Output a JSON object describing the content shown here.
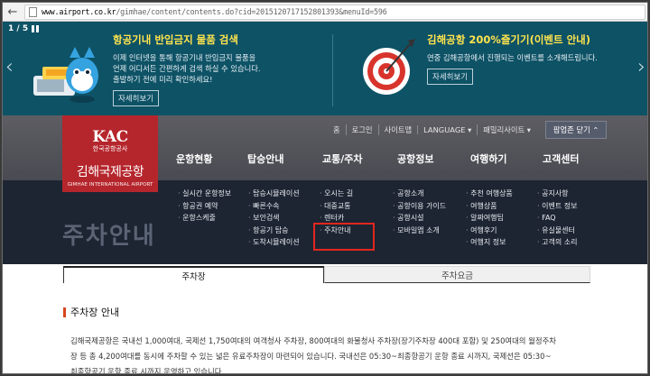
{
  "browser": {
    "url_host": "www.airport.co.kr",
    "url_rest": "/gimhae/content/contents.do?cid=2015120717152801393&menuId=596"
  },
  "banner": {
    "counter": "1 / 5",
    "slides": [
      {
        "title": "항공기내 반입금지 물품 검색",
        "lines": [
          "이제 인터넷을 통해 항공기내 반입금지 물품을",
          "언제 어디서든 간편하게 검색 하실 수 있습니다.",
          "출발하기 전에 미리 확인하세요!"
        ],
        "more": "자세히보기"
      },
      {
        "title": "김해공항 200%즐기기(이벤트 안내)",
        "lines": [
          "연중 김해공항에서 진행되는 이벤트를 소개해드립니다."
        ],
        "more": "자세히보기"
      }
    ]
  },
  "logo": {
    "kac": "KAC",
    "org": "한국공항공사",
    "name": "김해국제공항",
    "name_en": "GIMHAE INTERNATIONAL AIRPORT"
  },
  "util": {
    "items": [
      "홈",
      "로그인",
      "사이트맵",
      "LANGUAGE ▾",
      "패밀리사이트 ▾"
    ],
    "close_popup": "팝업존 닫기 ⌃"
  },
  "gnb": [
    "운항현황",
    "탑승안내",
    "교통/주차",
    "공항정보",
    "여행하기",
    "고객센터"
  ],
  "submenus": [
    [
      "실시간 운항정보",
      "항공권 예약",
      "운항스케줄"
    ],
    [
      "탑승시뮬레이션",
      "빠른수속",
      "보안검색",
      "항공기 탑승",
      "도착시뮬레이션"
    ],
    [
      "오시는 길",
      "대중교통",
      "렌터카",
      "주차안내"
    ],
    [
      "공항소개",
      "공항이용 가이드",
      "공항시설",
      "모바일앱 소개"
    ],
    [
      "추천 여행상품",
      "여행상품",
      "알짜여행팁",
      "여행후기",
      "여행지 정보"
    ],
    [
      "공지사항",
      "이벤트 정보",
      "FAQ",
      "유실물센터",
      "고객의 소리"
    ]
  ],
  "page": {
    "ghost_title": "주차안내",
    "tabs": [
      "주차장",
      "주차요금"
    ],
    "section_title": "주차장 안내",
    "paragraph_lines": [
      "김해국제공항은 국내선 1,000여대, 국제선 1,750여대의 여객청사 주차장, 800여대의 화물청사 주차장(장기주차장 400대 포함) 및 250여대의 월정주차",
      "장 등 총 4,200여대를 동시에 주차할 수 있는 넓은 유료주차장이 마련되어 있습니다. 국내선은 05:30~최종항공기 운항 종료 시까지, 국제선은 05:30~",
      "최종항공기 운항 종료 시까지 운영하고 있습니다."
    ]
  },
  "colors": {
    "banner_bg": "#0e5266",
    "logo_red": "#b5262c",
    "dropdown_bg": "#1d2533",
    "highlight": "#e3261e"
  }
}
